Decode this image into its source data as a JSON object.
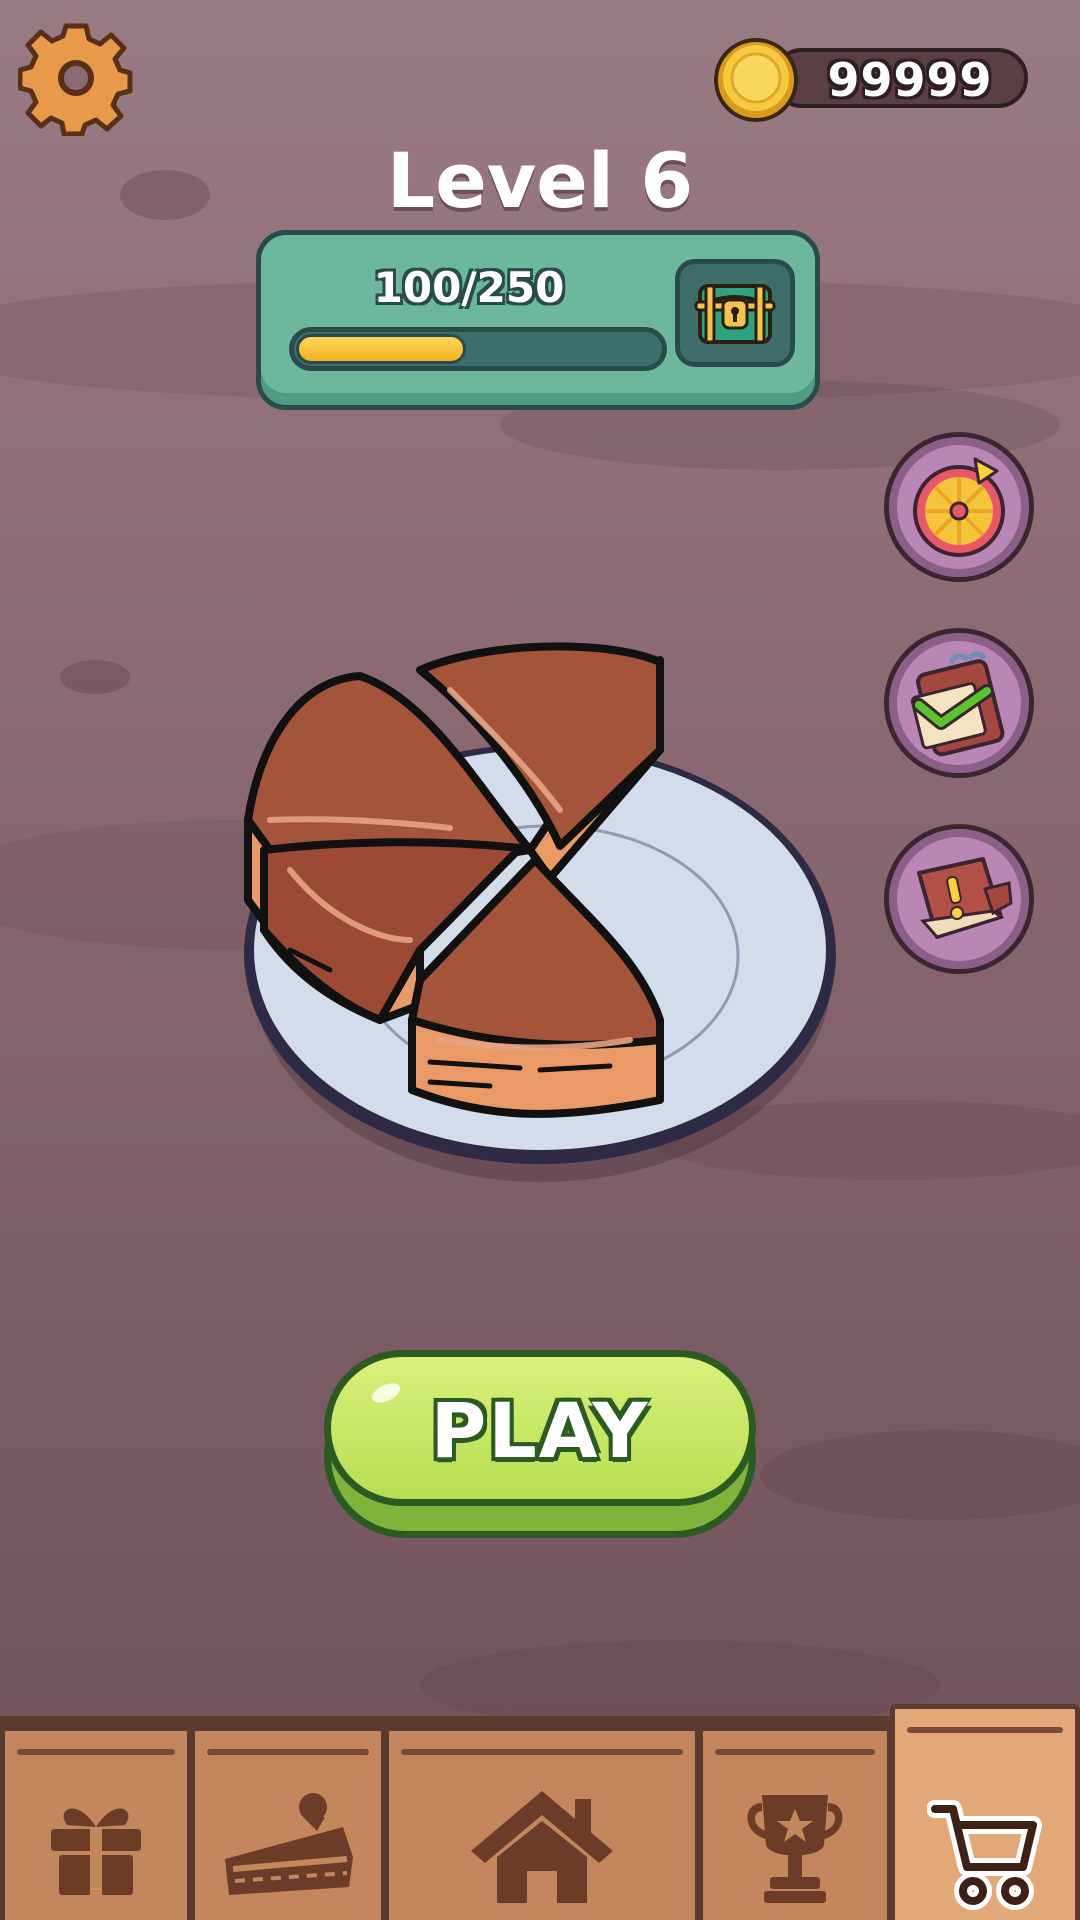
{
  "header": {
    "coins": "99999",
    "level_title": "Level 6"
  },
  "progress": {
    "text": "100/250",
    "current": 100,
    "max": 250
  },
  "side_buttons": [
    {
      "name": "lucky-wheel-button",
      "icon": "wheel-icon"
    },
    {
      "name": "daily-tasks-button",
      "icon": "calendar-check-icon"
    },
    {
      "name": "recipe-book-button",
      "icon": "book-alert-icon"
    }
  ],
  "play_button": {
    "label": "PLAY"
  },
  "nav": {
    "tabs": [
      {
        "name": "gift",
        "icon": "gift-icon",
        "active": false
      },
      {
        "name": "cake",
        "icon": "cake-slice-icon",
        "active": false
      },
      {
        "name": "home",
        "icon": "home-icon",
        "active": false
      },
      {
        "name": "trophy",
        "icon": "trophy-icon",
        "active": false
      },
      {
        "name": "shop",
        "icon": "cart-icon",
        "active": true
      }
    ]
  },
  "colors": {
    "background": "#8b6a74",
    "panel": "#6db79f",
    "play": "#b8de53",
    "nav_tab": "#c4865d",
    "nav_active": "#e2a877"
  }
}
